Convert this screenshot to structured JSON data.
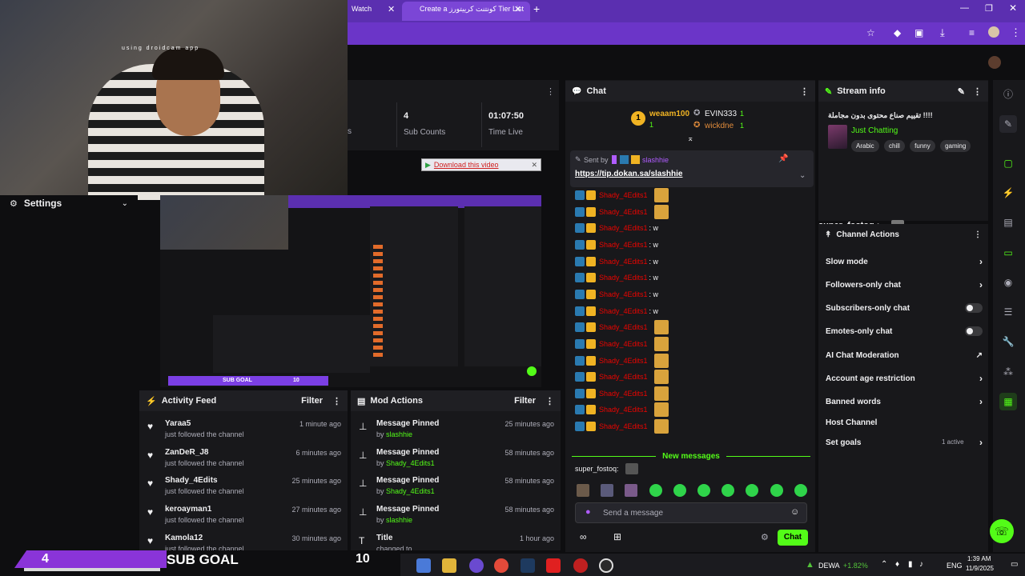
{
  "browser": {
    "tabs": [
      "Watch",
      "Create a كونتنت كرييتورز Tier List"
    ],
    "new_tab": "+"
  },
  "webcam": {
    "overlay_text": "using droidcam app"
  },
  "settings": {
    "label": "Settings"
  },
  "stats": {
    "subs_value": "4",
    "subs_label": "Sub Counts",
    "time_value": "01:07:50",
    "time_label": "Time Live",
    "partial_label": "s"
  },
  "download_btn": "Download this video",
  "chat": {
    "title": "Chat",
    "leaderboard": [
      {
        "rank": "1",
        "name": "weaam100",
        "count": "1"
      },
      {
        "name": "EVIN333",
        "count": "1"
      },
      {
        "name": "wickdne",
        "count": "1"
      }
    ],
    "pinned": {
      "sent_by": "Sent by",
      "user": "slashhie",
      "link": "https://tip.dokan.sa/slashhie"
    },
    "messages": [
      {
        "user": "Shady_4Edits1",
        "text": ""
      },
      {
        "user": "Shady_4Edits1",
        "text": ""
      },
      {
        "user": "Shady_4Edits1",
        "text": ": w"
      },
      {
        "user": "Shady_4Edits1",
        "text": ": w"
      },
      {
        "user": "Shady_4Edits1",
        "text": ": w"
      },
      {
        "user": "Shady_4Edits1",
        "text": ": w"
      },
      {
        "user": "Shady_4Edits1",
        "text": ": w"
      },
      {
        "user": "Shady_4Edits1",
        "text": ": w"
      },
      {
        "user": "Shady_4Edits1",
        "text": ""
      },
      {
        "user": "Shady_4Edits1",
        "text": ""
      },
      {
        "user": "Shady_4Edits1",
        "text": ""
      },
      {
        "user": "Shady_4Edits1",
        "text": ""
      },
      {
        "user": "Shady_4Edits1",
        "text": ""
      },
      {
        "user": "Shady_4Edits1",
        "text": ""
      },
      {
        "user": "Shady_4Edits1",
        "text": ""
      }
    ],
    "new_messages": "New messages",
    "last_user": "super_fostoq:",
    "input_placeholder": "Send a message",
    "chat_button": "Chat"
  },
  "stream_info": {
    "title": "Stream info",
    "stream_title": "!!!! تقييم صناع محتوى بدون مجاملة",
    "category": "Just Chatting",
    "tags": [
      "Arabic",
      "chill",
      "funny",
      "gaming"
    ]
  },
  "floating_user": "super_fostoq :",
  "channel_actions": {
    "title": "Channel Actions",
    "items": [
      {
        "label": "Slow mode",
        "control": "arrow"
      },
      {
        "label": "Followers-only chat",
        "control": "arrow"
      },
      {
        "label": "Subscribers-only chat",
        "control": "toggle"
      },
      {
        "label": "Emotes-only chat",
        "control": "toggle"
      },
      {
        "label": "AI Chat Moderation",
        "control": "external"
      },
      {
        "label": "Account age restriction",
        "control": "arrow"
      },
      {
        "label": "Banned words",
        "control": "arrow"
      },
      {
        "label": "Host Channel",
        "control": "none"
      },
      {
        "label": "Set goals",
        "control": "arrow"
      }
    ],
    "active_goals": "1 active"
  },
  "activity_feed": {
    "title": "Activity Feed",
    "filter": "Filter",
    "items": [
      {
        "name": "Yaraa5",
        "action": "just followed the channel",
        "time": "1 minute ago"
      },
      {
        "name": "ZanDeR_J8",
        "action": "just followed the channel",
        "time": "6 minutes ago"
      },
      {
        "name": "Shady_4Edits",
        "action": "just followed the channel",
        "time": "25 minutes ago"
      },
      {
        "name": "keroayman1",
        "action": "just followed the channel",
        "time": "27 minutes ago"
      },
      {
        "name": "Kamola12",
        "action": "just followed the channel",
        "time": "30 minutes ago"
      }
    ]
  },
  "mod_actions": {
    "title": "Mod Actions",
    "filter": "Filter",
    "items": [
      {
        "title": "Message Pinned",
        "by": "by",
        "user": "slashhie",
        "time": "25 minutes ago"
      },
      {
        "title": "Message Pinned",
        "by": "by",
        "user": "Shady_4Edits1",
        "time": "58 minutes ago"
      },
      {
        "title": "Message Pinned",
        "by": "by",
        "user": "Shady_4Edits1",
        "time": "58 minutes ago"
      },
      {
        "title": "Message Pinned",
        "by": "by",
        "user": "slashhie",
        "time": "58 minutes ago"
      },
      {
        "title": "Title",
        "by": "changed to",
        "user": "",
        "time": "1 hour ago"
      }
    ]
  },
  "sub_goal": {
    "current": "4",
    "label": "SUB GOAL",
    "target": "10",
    "mini_label": "SUB GOAL",
    "mini_target": "10"
  },
  "taskbar": {
    "weather_label": "DEWA",
    "weather_change": "+1.82%",
    "lang": "ENG",
    "time": "1:39 AM",
    "date": "11/9/2025"
  },
  "colors": {
    "accent": "#53fc18",
    "purple": "#7b3fe4",
    "chat_user_red": "#eb0400",
    "panel_bg": "#18181b"
  }
}
